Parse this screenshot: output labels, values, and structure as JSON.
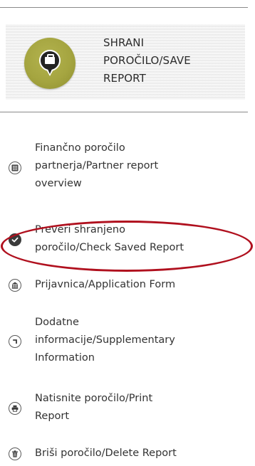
{
  "save_report": {
    "label_lines": [
      "SHRANI",
      "POROČILO/SAVE",
      "REPORT"
    ],
    "icon": "briefcase-pin-icon",
    "disc_color": "#a5a540"
  },
  "menu": {
    "items": [
      {
        "lines": [
          "Finančno poročilo",
          "partnerja/Partner report",
          "overview"
        ],
        "icon": "calculator-icon"
      },
      {
        "lines": [
          "Preveri shranjeno",
          "poročilo/Check Saved Report"
        ],
        "icon": "check-icon",
        "highlighted": true
      },
      {
        "lines": [
          "Prijavnica/Application Form"
        ],
        "icon": "building-icon"
      },
      {
        "lines": [
          "Dodatne",
          "informacije/Supplementary",
          "Information"
        ],
        "icon": "corner-arrow-icon"
      },
      {
        "lines": [
          "Natisnite poročilo/Print",
          "Report"
        ],
        "icon": "printer-icon"
      },
      {
        "lines": [
          "Briši poročilo/Delete Report"
        ],
        "icon": "trash-icon"
      }
    ]
  },
  "annotation": {
    "highlight_color": "#b0101e"
  }
}
